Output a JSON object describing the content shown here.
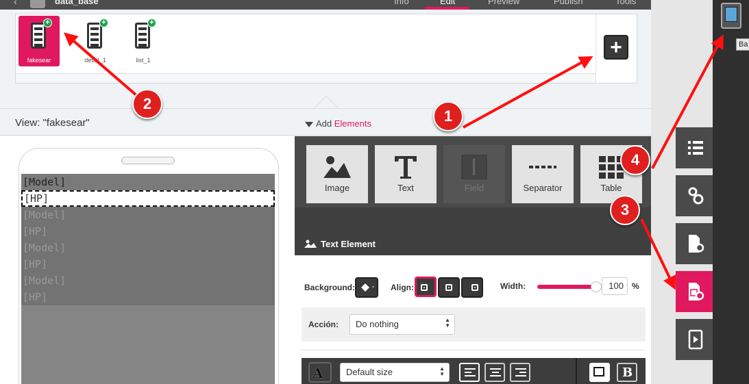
{
  "topnav": {
    "app_name": "data_base",
    "tabs": [
      "Info",
      "Edit",
      "Preview",
      "Publish",
      "Tools"
    ],
    "active_tab": "Edit"
  },
  "screens": [
    {
      "label": "fakesear",
      "active": true
    },
    {
      "label": "detail_1",
      "active": false
    },
    {
      "label": "list_1",
      "active": false
    }
  ],
  "view": {
    "title": "View: \"fakesear\"",
    "add_prefix": "Add ",
    "add_highlight": "Elements"
  },
  "phone_rows": [
    {
      "text": "[Model]",
      "style": "first"
    },
    {
      "text": "[HP]",
      "style": "selected"
    },
    {
      "text": "[Model]",
      "style": "dim"
    },
    {
      "text": "[HP]",
      "style": "dim"
    },
    {
      "text": "[Model]",
      "style": "dim"
    },
    {
      "text": "[HP]",
      "style": "dim"
    },
    {
      "text": "[Model]",
      "style": "dim"
    },
    {
      "text": "[HP]",
      "style": "dim"
    }
  ],
  "palette": [
    {
      "label": "Image",
      "icon": "image-icon",
      "disabled": false
    },
    {
      "label": "Text",
      "icon": "text-icon",
      "disabled": false
    },
    {
      "label": "Field",
      "icon": "field-icon",
      "disabled": true
    },
    {
      "label": "Separator",
      "icon": "separator-icon",
      "disabled": false
    },
    {
      "label": "Table",
      "icon": "table-icon",
      "disabled": false
    }
  ],
  "section": {
    "title": "Text Element"
  },
  "props": {
    "background_label": "Background:",
    "align_label": "Align:",
    "width_label": "Width:",
    "width_value": "100",
    "width_unit": "%",
    "accion_label": "Acción:",
    "accion_value": "Do nothing",
    "font_size_value": "Default size"
  },
  "tooltip": "Ba",
  "annotations": [
    "1",
    "2",
    "3",
    "4"
  ],
  "colors": {
    "accent": "#e0195f",
    "annotation": "#e01f1f"
  }
}
